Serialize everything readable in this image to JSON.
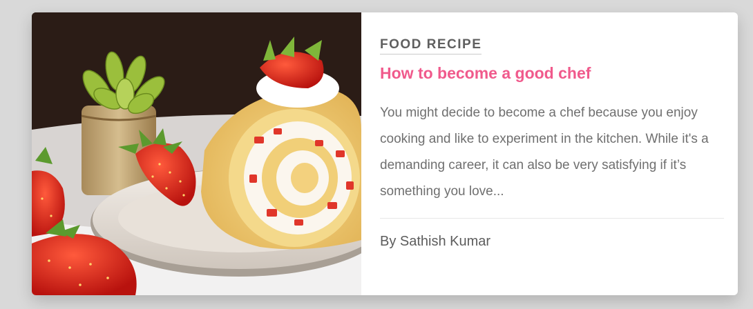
{
  "card": {
    "image_alt": "Strawberry cream roll cake on a plate",
    "category": "FOOD RECIPE",
    "title": "How to become a good chef",
    "excerpt": "You might decide to become a chef because you enjoy cooking and like to experiment in the kitchen. While it's a demanding career, it can also be very satisfying if it’s something you love...",
    "author": "By Sathish Kumar"
  },
  "colors": {
    "page_background": "#d9d9d9",
    "card_background": "#ffffff",
    "title_accent": "#f05a8c",
    "category_text": "#5f5f5f",
    "body_text": "#6f6f6f"
  }
}
